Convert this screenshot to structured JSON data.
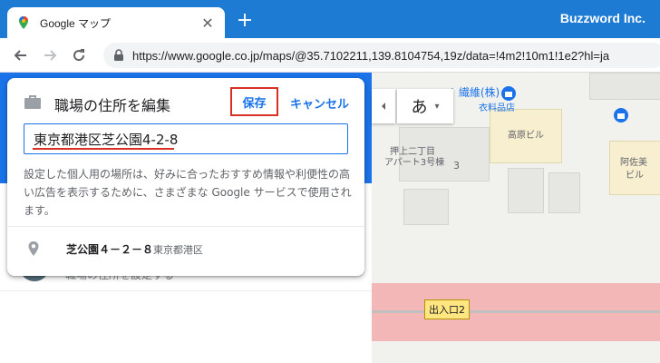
{
  "browser": {
    "tab_title": "Google マップ",
    "close_glyph": "✕",
    "new_tab_glyph": "+",
    "brand": "Buzzword Inc.",
    "url": "https://www.google.co.jp/maps/@35.7102211,139.8104754,19z/data=!4m2!10m1!1e2?hl=ja"
  },
  "dialog": {
    "title": "職場の住所を編集",
    "save_label": "保存",
    "cancel_label": "キャンセル",
    "address_value": "東京都港区芝公園4-2-8",
    "description": "設定した個人用の場所は、好みに合ったおすすめ情報や利便性の高い広告を表示するために、さまざまな Google サービスで使用されます。",
    "suggestion_main": "芝公園４－２－８",
    "suggestion_sub": "東京都港区"
  },
  "map": {
    "lang_glyph": "あ",
    "caret": "▾",
    "label_shop": "ノ 繊維(株)",
    "label_shop_sub": "衣料品店",
    "label_bldg1": "高原ビル",
    "label_bldg2": "阿佐美",
    "label_bldg2b": "ビル",
    "label_apart": "押上二丁目",
    "label_apart2": "アパート3号棟",
    "label_block": "3",
    "exit_label": "出入口2"
  },
  "panel": {
    "ghost_text": "職場の住所を設定する"
  },
  "colors": {
    "accent": "#1a73e8",
    "save_border": "#d93025",
    "tab_strip": "#1e7bd3"
  }
}
